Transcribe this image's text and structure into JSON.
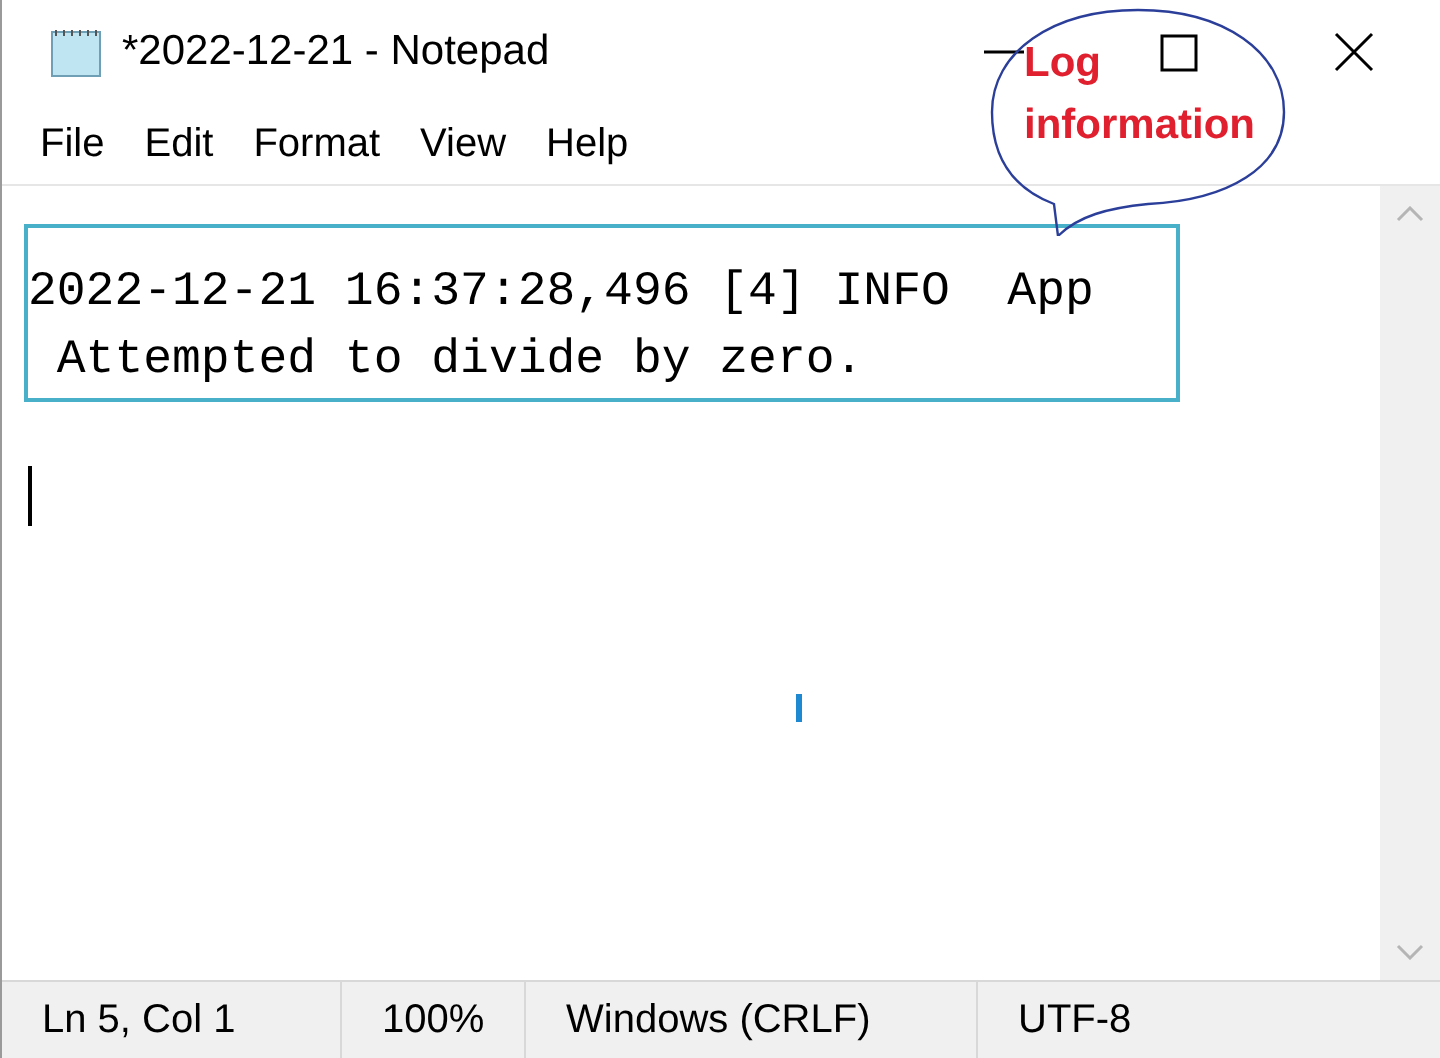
{
  "window": {
    "title": "*2022-12-21 - Notepad"
  },
  "menu": [
    "File",
    "Edit",
    "Format",
    "View",
    "Help"
  ],
  "editor": {
    "lines": [
      "2022-12-21 16:37:28,496 [4] INFO  App",
      " Attempted to divide by zero."
    ]
  },
  "callout": {
    "lines": [
      "Log",
      "information"
    ]
  },
  "status_bar": [
    "Ln 5, Col 1",
    "100%",
    "Windows (CRLF)",
    "UTF-8"
  ]
}
